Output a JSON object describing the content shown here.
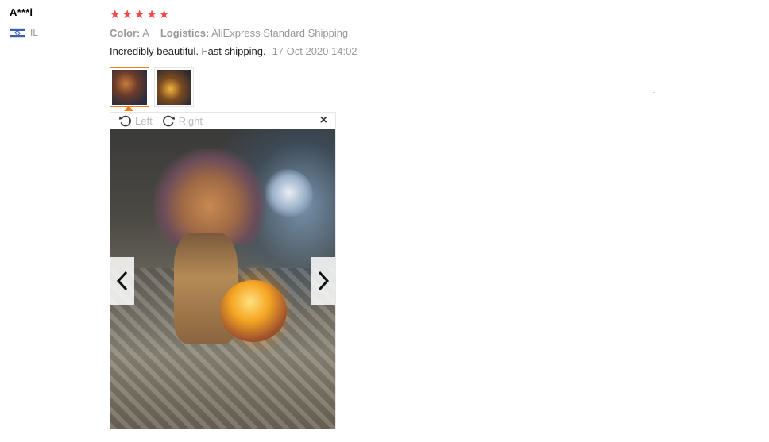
{
  "user": {
    "name": "A***i",
    "country": "IL"
  },
  "review": {
    "rating": 5,
    "stars": [
      "★",
      "★",
      "★",
      "★",
      "★"
    ],
    "color_label": "Color:",
    "color_value": "A",
    "logistics_label": "Logistics:",
    "logistics_value": "AliExpress Standard Shipping",
    "text": "Incredibly beautiful. Fast shipping.",
    "date": "17 Oct 2020 14:02"
  },
  "viewer": {
    "rotate_left_label": "Left",
    "rotate_right_label": "Right",
    "close_glyph": "×"
  },
  "colors": {
    "star": "#f44848",
    "active_border": "#f07d1b",
    "muted_text": "#999999"
  }
}
